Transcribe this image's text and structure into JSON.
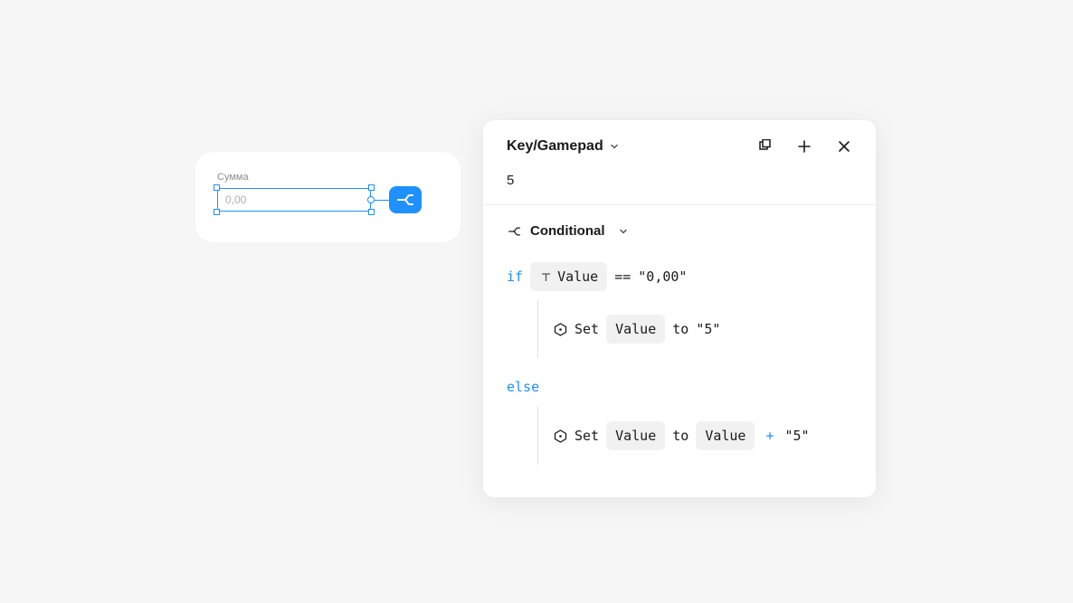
{
  "card": {
    "label": "Сумма",
    "value_placeholder": "0,00"
  },
  "panel": {
    "title": "Key/Gamepad",
    "input_value": "5",
    "section_label": "Conditional",
    "if_kw": "if",
    "else_kw": "else",
    "op_eq": "==",
    "op_plus": "+",
    "token_value": "Value",
    "set_word": "Set",
    "to_word": "to",
    "quoted_000": "\"0,00\"",
    "quoted_5": "\"5\""
  }
}
